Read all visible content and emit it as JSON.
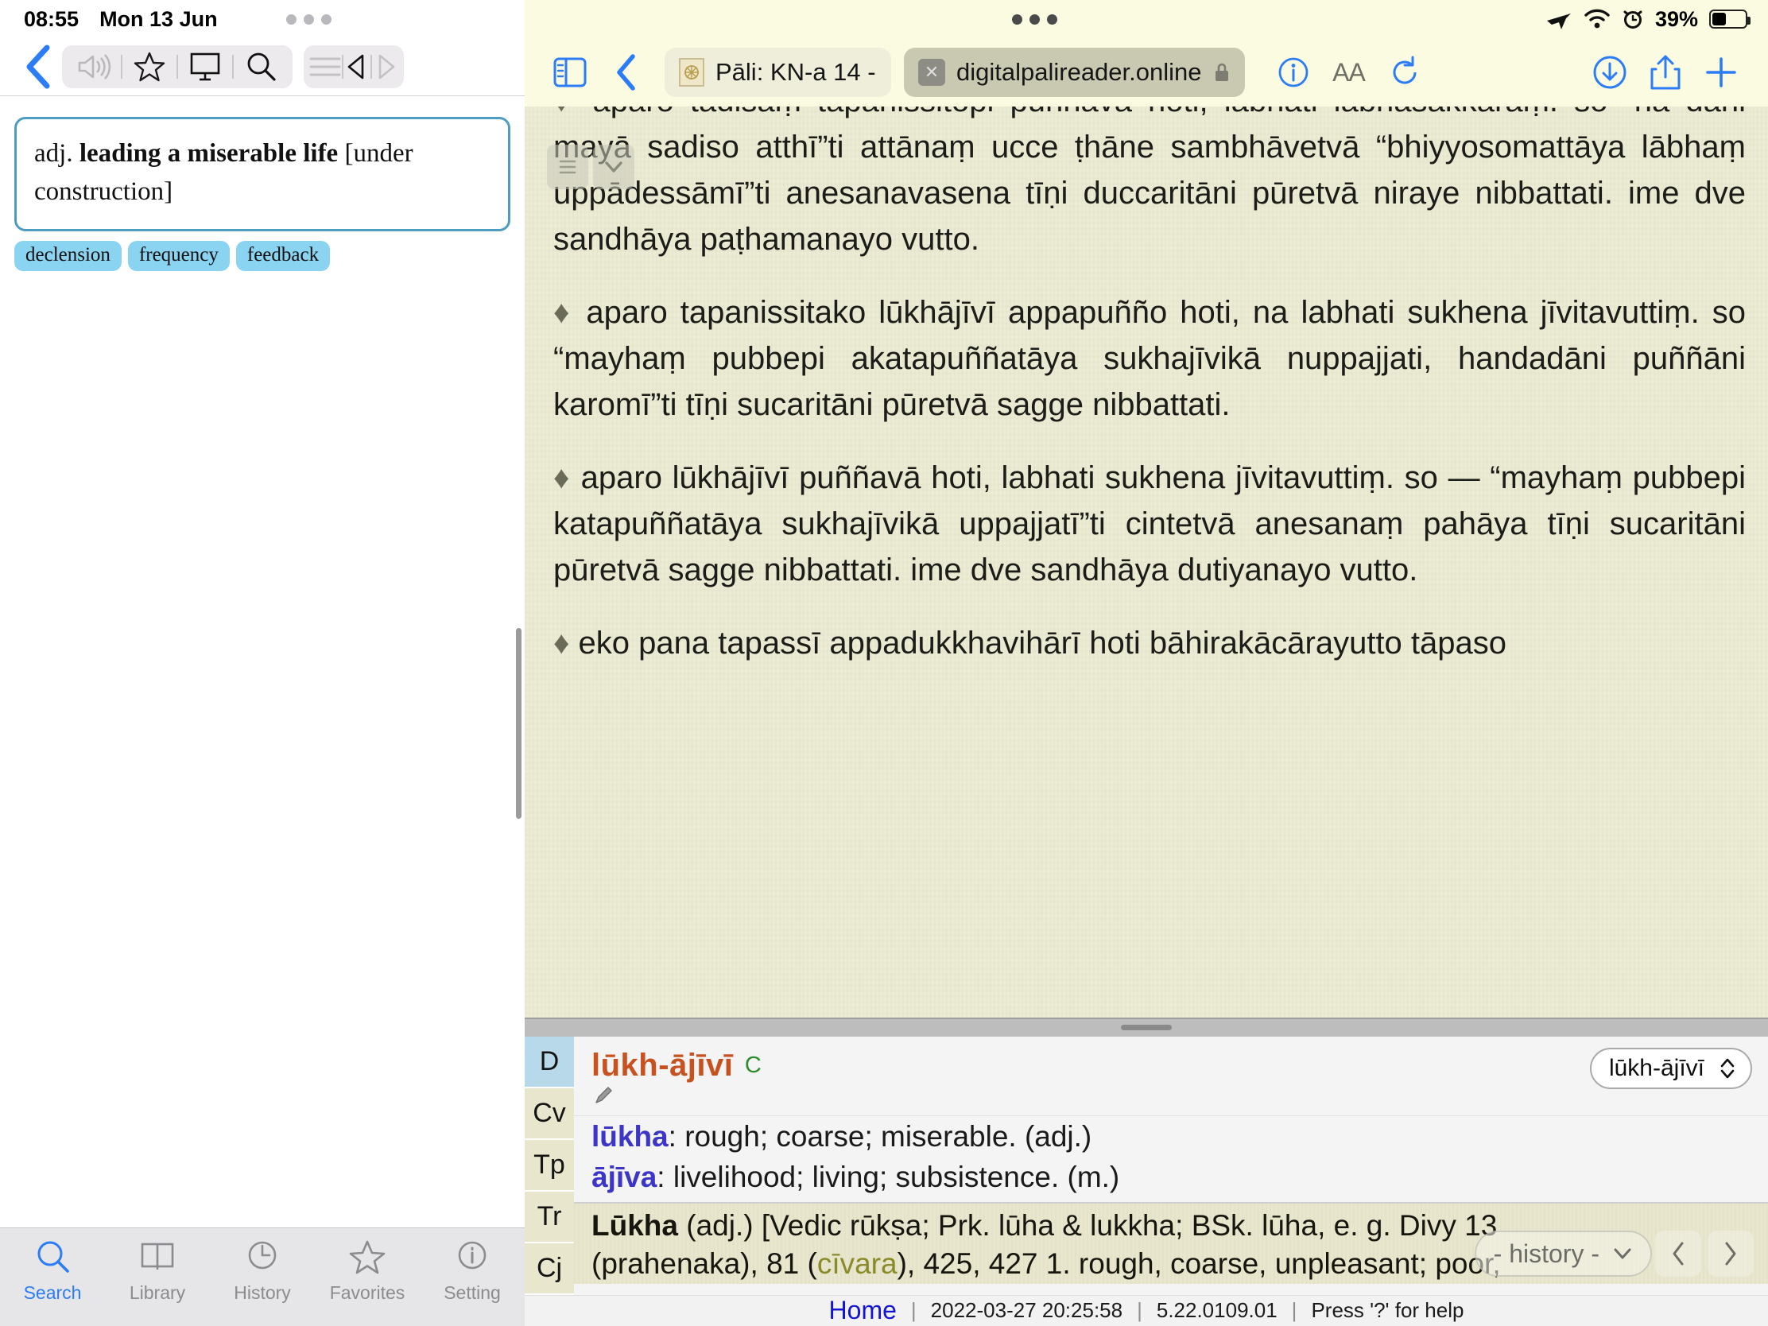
{
  "left_app": {
    "status_bar": {
      "time": "08:55",
      "date": "Mon 13 Jun"
    },
    "toolbar": {
      "back_label": "Back",
      "icons": [
        "speaker-icon",
        "star-icon",
        "display-icon",
        "search-icon",
        "list-icon",
        "prev-icon",
        "next-icon"
      ]
    },
    "entry": {
      "pos": "adj.",
      "headword_gloss": "leading a miserable life",
      "note": "[under construction]",
      "full_text": "adj. leading a miserable life [under construction]"
    },
    "tags": [
      "declension",
      "frequency",
      "feedback"
    ],
    "tabbar": [
      {
        "label": "Search",
        "icon": "search-icon",
        "active": true
      },
      {
        "label": "Library",
        "icon": "book-icon",
        "active": false
      },
      {
        "label": "History",
        "icon": "clock-icon",
        "active": false
      },
      {
        "label": "Favorites",
        "icon": "star-icon",
        "active": false
      },
      {
        "label": "Setting",
        "icon": "info-icon",
        "active": false
      }
    ],
    "accent_color": "#2b7cf6",
    "card_border_color": "#4e9cc0",
    "tag_color": "#8ad4f2"
  },
  "browser": {
    "status_bar": {
      "airplane": "airplane-icon",
      "wifi": "wifi-icon",
      "alarm": "alarm-icon",
      "battery_percent": "39%"
    },
    "toolbar": {
      "sidebar_icon": "sidebar-icon",
      "back_icon": "chevron-left-icon",
      "reader_icon": "info-icon",
      "text_size_label": "AA",
      "reload_icon": "reload-icon",
      "download_icon": "download-icon",
      "share_icon": "share-icon",
      "new_tab_icon": "plus-icon"
    },
    "tabs": [
      {
        "title": "Pāli: KN-a 14 - [",
        "active": false,
        "favicon": "dharma-wheel-icon"
      },
      {
        "title": "digitalpalireader.online",
        "active": true,
        "lock": "lock-icon"
      }
    ]
  },
  "page": {
    "paragraphs": [
      "aparo tādisaṃ tapanissitopi puññavā hoti, labhati lābhasakkāraṃ. so “na dāni mayā sadiso atthī”ti attānaṃ ucce ṭhāne sambhāvetvā “bhiyyosomattāya lābhaṃ uppādessāmī”ti anesanavasena tīṇi duccaritāni pūretvā niraye nibbattati. ime dve sandhāya paṭhamanayo vutto.",
      "aparo tapanissitako lūkhājīvī appapuñño hoti, na labhati sukhena jīvitavuttiṃ. so “mayhaṃ pubbepi akatapuññatāya sukhajīvikā nuppajjati, handadāni puññāni karomī”ti tīṇi sucaritāni pūretvā sagge nibbattati.",
      "aparo lūkhājīvī puññavā hoti, labhati sukhena jīvitavuttiṃ. so — “mayhaṃ pubbepi katapuññatāya sukhajīvikā uppajjatī”ti cintetvā anesanaṃ pahāya tīṇi sucaritāni pūretvā sagge nibbattati. ime dve sandhāya dutiyanayo vutto.",
      "eko pana tapassī appadukkhavihārī hoti bāhirakācārayutto tāpaso"
    ],
    "bullet": "♦",
    "floating_icons": [
      "menu-icon",
      "chevron-down-icon"
    ]
  },
  "dictionary": {
    "side_tabs": [
      {
        "label": "D",
        "selected": true
      },
      {
        "label": "Cv",
        "selected": false
      },
      {
        "label": "Tp",
        "selected": false
      },
      {
        "label": "Tr",
        "selected": false
      },
      {
        "label": "Cj",
        "selected": false
      }
    ],
    "headword": "lūkh-ājīvī",
    "headword_prefix": "lūkh",
    "headword_hyphen": "-",
    "headword_suffix": "ājīvī",
    "c_marker": "C",
    "edit_icon": "pencil-icon",
    "select_value": "lūkh-ājīvī",
    "entries": [
      {
        "term": "lūkha",
        "gloss": ": rough; coarse; miserable. (adj.)"
      },
      {
        "term": "ājīva",
        "gloss": ": livelihood; living; subsistence. (m.)"
      }
    ],
    "pts_entry_line1_bold": "Lūkha",
    "pts_entry_line1": " (adj.) [Vedic rūkṣa; Prk. lūha & lukkha; BSk. lūha, e. g. Divy 13",
    "pts_entry_line2_a": "(prahenaka), 81 (",
    "pts_entry_line2_olive": "cīvara",
    "pts_entry_line2_b": "), 425, 427 1. rough, coarse, unpleasant; poor,",
    "history_label": "- history -",
    "history_caret": "chevron-down-icon",
    "nav_prev": "‹",
    "nav_next": "›",
    "footer": {
      "home": "Home",
      "timestamp": "2022-03-27 20:25:58",
      "version": "5.22.0109.01",
      "help": "Press '?' for help"
    },
    "headword_color": "#c8521f",
    "term_color": "#3b35c8",
    "selected_tab_color": "#b8d9ea"
  }
}
